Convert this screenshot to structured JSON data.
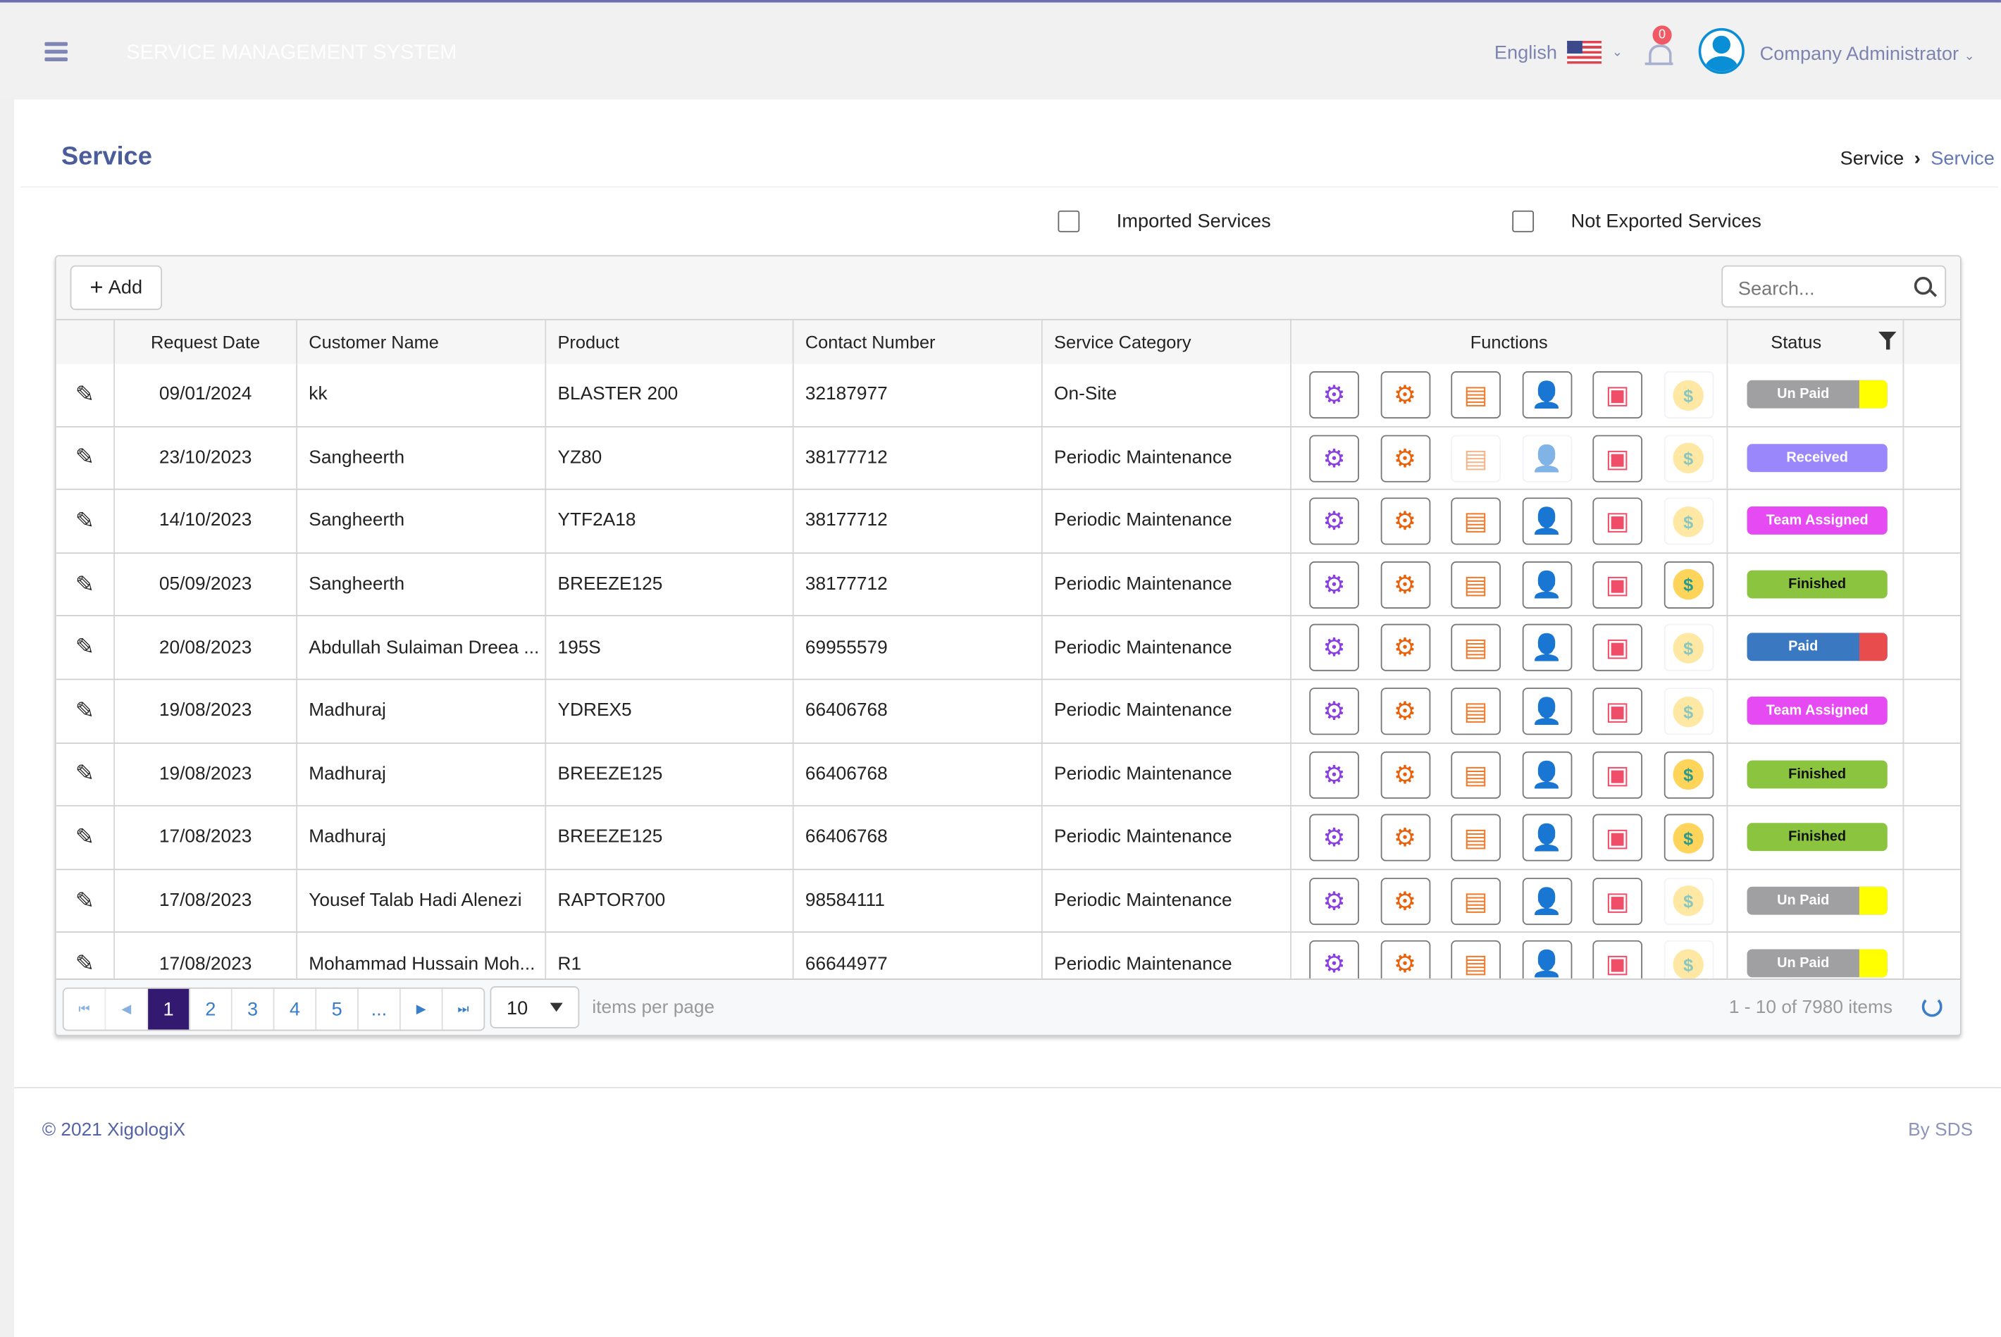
{
  "header": {
    "app_title": "SERVICE MANAGEMENT SYSTEM",
    "language": "English",
    "notification_count": "0",
    "user": "Company Administrator"
  },
  "page": {
    "title": "Service",
    "breadcrumb": [
      "Service",
      "Service"
    ]
  },
  "filters": {
    "imported": "Imported Services",
    "not_exported": "Not Exported Services"
  },
  "toolbar": {
    "add_label": "Add",
    "search_placeholder": "Search..."
  },
  "columns": [
    "Request Date",
    "Customer Name",
    "Product",
    "Contact Number",
    "Service Category",
    "Functions",
    "Status"
  ],
  "functions": [
    "service-settings",
    "spare-parts",
    "invoice",
    "technician",
    "images",
    "payment"
  ],
  "status_colors": {
    "Un Paid": [
      "#a0a0a3",
      "#ffff00"
    ],
    "Received": [
      "#9b87fc",
      null
    ],
    "Team Assigned": [
      "#e64af2",
      null
    ],
    "Finished": [
      "#8bc540",
      null
    ],
    "Paid": [
      "#3b78c2",
      "#e84c4c"
    ]
  },
  "rows": [
    {
      "date": "09/01/2024",
      "customer": "kk",
      "product": "BLASTER 200",
      "contact": "32187977",
      "category": "On-Site",
      "enabled": [
        1,
        1,
        1,
        1,
        1,
        0
      ],
      "status": "Un Paid"
    },
    {
      "date": "23/10/2023",
      "customer": "Sangheerth",
      "product": "YZ80",
      "contact": "38177712",
      "category": "Periodic Maintenance",
      "enabled": [
        1,
        1,
        0,
        0,
        1,
        0
      ],
      "status": "Received"
    },
    {
      "date": "14/10/2023",
      "customer": "Sangheerth",
      "product": "YTF2A18",
      "contact": "38177712",
      "category": "Periodic Maintenance",
      "enabled": [
        1,
        1,
        1,
        1,
        1,
        0
      ],
      "status": "Team Assigned"
    },
    {
      "date": "05/09/2023",
      "customer": "Sangheerth",
      "product": "BREEZE125",
      "contact": "38177712",
      "category": "Periodic Maintenance",
      "enabled": [
        1,
        1,
        1,
        1,
        1,
        1
      ],
      "status": "Finished"
    },
    {
      "date": "20/08/2023",
      "customer": "Abdullah Sulaiman Dreea ...",
      "product": "195S",
      "contact": "69955579",
      "category": "Periodic Maintenance",
      "enabled": [
        1,
        1,
        1,
        1,
        1,
        0
      ],
      "status": "Paid"
    },
    {
      "date": "19/08/2023",
      "customer": "Madhuraj",
      "product": "YDREX5",
      "contact": "66406768",
      "category": "Periodic Maintenance",
      "enabled": [
        1,
        1,
        1,
        1,
        1,
        0
      ],
      "status": "Team Assigned"
    },
    {
      "date": "19/08/2023",
      "customer": "Madhuraj",
      "product": "BREEZE125",
      "contact": "66406768",
      "category": "Periodic Maintenance",
      "enabled": [
        1,
        1,
        1,
        1,
        1,
        1
      ],
      "status": "Finished"
    },
    {
      "date": "17/08/2023",
      "customer": "Madhuraj",
      "product": "BREEZE125",
      "contact": "66406768",
      "category": "Periodic Maintenance",
      "enabled": [
        1,
        1,
        1,
        1,
        1,
        1
      ],
      "status": "Finished"
    },
    {
      "date": "17/08/2023",
      "customer": "Yousef Talab Hadi Alenezi",
      "product": "RAPTOR700",
      "contact": "98584111",
      "category": "Periodic Maintenance",
      "enabled": [
        1,
        1,
        1,
        1,
        1,
        0
      ],
      "status": "Un Paid"
    },
    {
      "date": "17/08/2023",
      "customer": "Mohammad Hussain Moh...",
      "product": "R1",
      "contact": "66644977",
      "category": "Periodic Maintenance",
      "enabled": [
        1,
        1,
        1,
        1,
        1,
        0
      ],
      "status": "Un Paid"
    }
  ],
  "pagination": {
    "pages": [
      "1",
      "2",
      "3",
      "4",
      "5",
      "..."
    ],
    "current": "1",
    "page_size": "10",
    "items_per_page_label": "items per page",
    "info": "1 - 10 of 7980 items"
  },
  "footer": {
    "copyright": "© 2021 XigologiX",
    "by": "By SDS"
  }
}
